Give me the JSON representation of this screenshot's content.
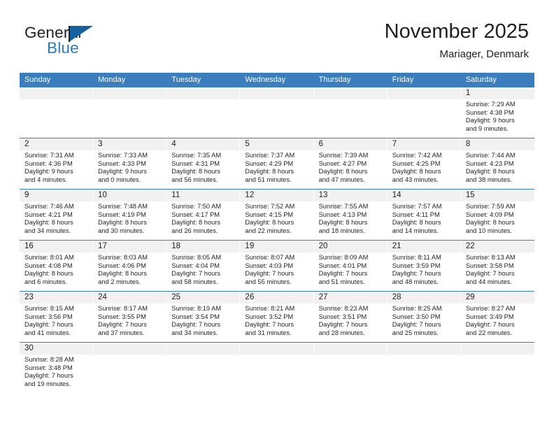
{
  "brand": {
    "word_one": "General",
    "word_two": "Blue",
    "color_dark": "#231f20",
    "color_blue": "#2b7cc0",
    "flag_color": "#14619e"
  },
  "header": {
    "title": "November 2025",
    "subtitle": "Mariager, Denmark"
  },
  "theme": {
    "header_bg": "#3b7dbd",
    "date_band_bg": "#f1f1f1",
    "text": "#231f20"
  },
  "weekdays": [
    "Sunday",
    "Monday",
    "Tuesday",
    "Wednesday",
    "Thursday",
    "Friday",
    "Saturday"
  ],
  "weeks": [
    [
      {
        "date": "",
        "sunrise": "",
        "sunset": "",
        "daylight_line1": "",
        "daylight_line2": "",
        "empty": true
      },
      {
        "date": "",
        "sunrise": "",
        "sunset": "",
        "daylight_line1": "",
        "daylight_line2": "",
        "empty": true
      },
      {
        "date": "",
        "sunrise": "",
        "sunset": "",
        "daylight_line1": "",
        "daylight_line2": "",
        "empty": true
      },
      {
        "date": "",
        "sunrise": "",
        "sunset": "",
        "daylight_line1": "",
        "daylight_line2": "",
        "empty": true
      },
      {
        "date": "",
        "sunrise": "",
        "sunset": "",
        "daylight_line1": "",
        "daylight_line2": "",
        "empty": true
      },
      {
        "date": "",
        "sunrise": "",
        "sunset": "",
        "daylight_line1": "",
        "daylight_line2": "",
        "empty": true
      },
      {
        "date": "1",
        "sunrise": "Sunrise: 7:29 AM",
        "sunset": "Sunset: 4:38 PM",
        "daylight_line1": "Daylight: 9 hours",
        "daylight_line2": "and 9 minutes."
      }
    ],
    [
      {
        "date": "2",
        "sunrise": "Sunrise: 7:31 AM",
        "sunset": "Sunset: 4:36 PM",
        "daylight_line1": "Daylight: 9 hours",
        "daylight_line2": "and 4 minutes."
      },
      {
        "date": "3",
        "sunrise": "Sunrise: 7:33 AM",
        "sunset": "Sunset: 4:33 PM",
        "daylight_line1": "Daylight: 9 hours",
        "daylight_line2": "and 0 minutes."
      },
      {
        "date": "4",
        "sunrise": "Sunrise: 7:35 AM",
        "sunset": "Sunset: 4:31 PM",
        "daylight_line1": "Daylight: 8 hours",
        "daylight_line2": "and 56 minutes."
      },
      {
        "date": "5",
        "sunrise": "Sunrise: 7:37 AM",
        "sunset": "Sunset: 4:29 PM",
        "daylight_line1": "Daylight: 8 hours",
        "daylight_line2": "and 51 minutes."
      },
      {
        "date": "6",
        "sunrise": "Sunrise: 7:39 AM",
        "sunset": "Sunset: 4:27 PM",
        "daylight_line1": "Daylight: 8 hours",
        "daylight_line2": "and 47 minutes."
      },
      {
        "date": "7",
        "sunrise": "Sunrise: 7:42 AM",
        "sunset": "Sunset: 4:25 PM",
        "daylight_line1": "Daylight: 8 hours",
        "daylight_line2": "and 43 minutes."
      },
      {
        "date": "8",
        "sunrise": "Sunrise: 7:44 AM",
        "sunset": "Sunset: 4:23 PM",
        "daylight_line1": "Daylight: 8 hours",
        "daylight_line2": "and 38 minutes."
      }
    ],
    [
      {
        "date": "9",
        "sunrise": "Sunrise: 7:46 AM",
        "sunset": "Sunset: 4:21 PM",
        "daylight_line1": "Daylight: 8 hours",
        "daylight_line2": "and 34 minutes."
      },
      {
        "date": "10",
        "sunrise": "Sunrise: 7:48 AM",
        "sunset": "Sunset: 4:19 PM",
        "daylight_line1": "Daylight: 8 hours",
        "daylight_line2": "and 30 minutes."
      },
      {
        "date": "11",
        "sunrise": "Sunrise: 7:50 AM",
        "sunset": "Sunset: 4:17 PM",
        "daylight_line1": "Daylight: 8 hours",
        "daylight_line2": "and 26 minutes."
      },
      {
        "date": "12",
        "sunrise": "Sunrise: 7:52 AM",
        "sunset": "Sunset: 4:15 PM",
        "daylight_line1": "Daylight: 8 hours",
        "daylight_line2": "and 22 minutes."
      },
      {
        "date": "13",
        "sunrise": "Sunrise: 7:55 AM",
        "sunset": "Sunset: 4:13 PM",
        "daylight_line1": "Daylight: 8 hours",
        "daylight_line2": "and 18 minutes."
      },
      {
        "date": "14",
        "sunrise": "Sunrise: 7:57 AM",
        "sunset": "Sunset: 4:11 PM",
        "daylight_line1": "Daylight: 8 hours",
        "daylight_line2": "and 14 minutes."
      },
      {
        "date": "15",
        "sunrise": "Sunrise: 7:59 AM",
        "sunset": "Sunset: 4:09 PM",
        "daylight_line1": "Daylight: 8 hours",
        "daylight_line2": "and 10 minutes."
      }
    ],
    [
      {
        "date": "16",
        "sunrise": "Sunrise: 8:01 AM",
        "sunset": "Sunset: 4:08 PM",
        "daylight_line1": "Daylight: 8 hours",
        "daylight_line2": "and 6 minutes."
      },
      {
        "date": "17",
        "sunrise": "Sunrise: 8:03 AM",
        "sunset": "Sunset: 4:06 PM",
        "daylight_line1": "Daylight: 8 hours",
        "daylight_line2": "and 2 minutes."
      },
      {
        "date": "18",
        "sunrise": "Sunrise: 8:05 AM",
        "sunset": "Sunset: 4:04 PM",
        "daylight_line1": "Daylight: 7 hours",
        "daylight_line2": "and 58 minutes."
      },
      {
        "date": "19",
        "sunrise": "Sunrise: 8:07 AM",
        "sunset": "Sunset: 4:03 PM",
        "daylight_line1": "Daylight: 7 hours",
        "daylight_line2": "and 55 minutes."
      },
      {
        "date": "20",
        "sunrise": "Sunrise: 8:09 AM",
        "sunset": "Sunset: 4:01 PM",
        "daylight_line1": "Daylight: 7 hours",
        "daylight_line2": "and 51 minutes."
      },
      {
        "date": "21",
        "sunrise": "Sunrise: 8:11 AM",
        "sunset": "Sunset: 3:59 PM",
        "daylight_line1": "Daylight: 7 hours",
        "daylight_line2": "and 48 minutes."
      },
      {
        "date": "22",
        "sunrise": "Sunrise: 8:13 AM",
        "sunset": "Sunset: 3:58 PM",
        "daylight_line1": "Daylight: 7 hours",
        "daylight_line2": "and 44 minutes."
      }
    ],
    [
      {
        "date": "23",
        "sunrise": "Sunrise: 8:15 AM",
        "sunset": "Sunset: 3:56 PM",
        "daylight_line1": "Daylight: 7 hours",
        "daylight_line2": "and 41 minutes."
      },
      {
        "date": "24",
        "sunrise": "Sunrise: 8:17 AM",
        "sunset": "Sunset: 3:55 PM",
        "daylight_line1": "Daylight: 7 hours",
        "daylight_line2": "and 37 minutes."
      },
      {
        "date": "25",
        "sunrise": "Sunrise: 8:19 AM",
        "sunset": "Sunset: 3:54 PM",
        "daylight_line1": "Daylight: 7 hours",
        "daylight_line2": "and 34 minutes."
      },
      {
        "date": "26",
        "sunrise": "Sunrise: 8:21 AM",
        "sunset": "Sunset: 3:52 PM",
        "daylight_line1": "Daylight: 7 hours",
        "daylight_line2": "and 31 minutes."
      },
      {
        "date": "27",
        "sunrise": "Sunrise: 8:23 AM",
        "sunset": "Sunset: 3:51 PM",
        "daylight_line1": "Daylight: 7 hours",
        "daylight_line2": "and 28 minutes."
      },
      {
        "date": "28",
        "sunrise": "Sunrise: 8:25 AM",
        "sunset": "Sunset: 3:50 PM",
        "daylight_line1": "Daylight: 7 hours",
        "daylight_line2": "and 25 minutes."
      },
      {
        "date": "29",
        "sunrise": "Sunrise: 8:27 AM",
        "sunset": "Sunset: 3:49 PM",
        "daylight_line1": "Daylight: 7 hours",
        "daylight_line2": "and 22 minutes."
      }
    ],
    [
      {
        "date": "30",
        "sunrise": "Sunrise: 8:28 AM",
        "sunset": "Sunset: 3:48 PM",
        "daylight_line1": "Daylight: 7 hours",
        "daylight_line2": "and 19 minutes."
      },
      {
        "date": "",
        "sunrise": "",
        "sunset": "",
        "daylight_line1": "",
        "daylight_line2": "",
        "empty": true
      },
      {
        "date": "",
        "sunrise": "",
        "sunset": "",
        "daylight_line1": "",
        "daylight_line2": "",
        "empty": true
      },
      {
        "date": "",
        "sunrise": "",
        "sunset": "",
        "daylight_line1": "",
        "daylight_line2": "",
        "empty": true
      },
      {
        "date": "",
        "sunrise": "",
        "sunset": "",
        "daylight_line1": "",
        "daylight_line2": "",
        "empty": true
      },
      {
        "date": "",
        "sunrise": "",
        "sunset": "",
        "daylight_line1": "",
        "daylight_line2": "",
        "empty": true
      },
      {
        "date": "",
        "sunrise": "",
        "sunset": "",
        "daylight_line1": "",
        "daylight_line2": "",
        "empty": true
      }
    ]
  ]
}
